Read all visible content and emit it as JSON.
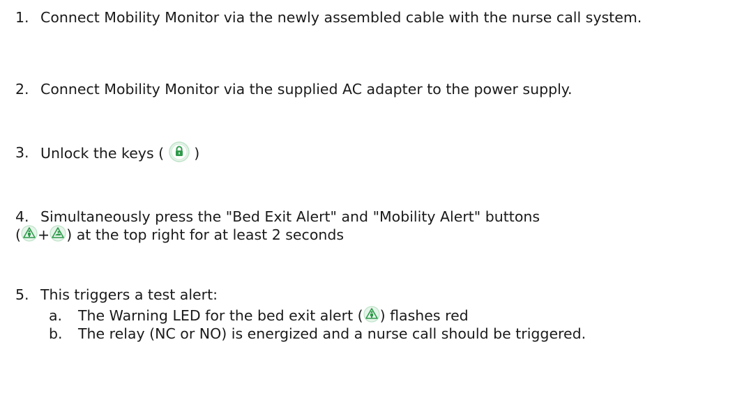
{
  "steps": [
    {
      "number": "1.",
      "text": "Connect Mobility Monitor via the newly assembled cable with the nurse call system."
    },
    {
      "number": "2.",
      "text": "Connect Mobility Monitor via the supplied AC adapter to the power supply."
    },
    {
      "number": "3.",
      "text_before": "Unlock the keys (",
      "text_after": ")",
      "icon": "lock-key-icon"
    },
    {
      "number": "4.",
      "text_line1": "Simultaneously press the \"Bed Exit Alert\" and \"Mobility Alert\" buttons",
      "text_line2_open": "(",
      "plus": "+",
      "text_line2_after": ") at the top right for at least 2 seconds",
      "icons": [
        "bed-exit-alert-icon",
        "mobility-alert-icon"
      ]
    },
    {
      "number": "5.",
      "text": "This triggers a test alert:",
      "substeps": [
        {
          "letter": "a.",
          "text_before": "The Warning LED for the bed exit alert (",
          "text_after": ") flashes red",
          "icon": "bed-exit-alert-icon"
        },
        {
          "letter": "b.",
          "text": "The relay (NC or NO) is energized and a nurse call should be triggered."
        }
      ]
    }
  ],
  "colors": {
    "icon_green": "#2e9a4a",
    "icon_ring": "#bfe3c8",
    "text": "#1a1a1a"
  }
}
